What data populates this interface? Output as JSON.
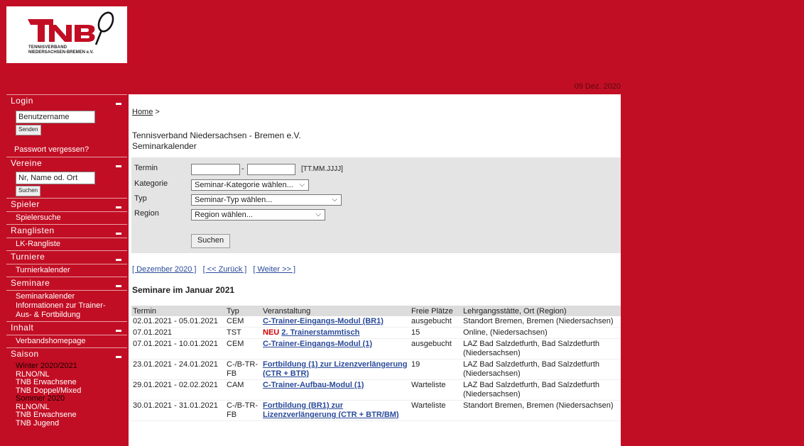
{
  "header": {
    "logo_line1": "TENNISVERBAND",
    "logo_line2": "NIEDERSACHSEN-BREMEN e.V.",
    "date": "09 Dez. 2020"
  },
  "sidebar": {
    "login": {
      "title": "Login",
      "username_value": "Benutzername",
      "send_label": "Senden",
      "forgot": "Passwort vergessen?"
    },
    "vereine": {
      "title": "Vereine",
      "search_placeholder": "Nr, Name od. Ort",
      "search_label": "Suchen"
    },
    "spieler": {
      "title": "Spieler",
      "item": "Spielersuche"
    },
    "ranglisten": {
      "title": "Ranglisten",
      "item": "LK-Rangliste"
    },
    "turniere": {
      "title": "Turniere",
      "item": "Turnierkalender"
    },
    "seminare": {
      "title": "Seminare",
      "item1": "Seminarkalender",
      "item2": "Informationen zur Trainer-Aus- & Fortbildung"
    },
    "inhalt": {
      "title": "Inhalt",
      "item": "Verbandshomepage"
    },
    "saison": {
      "title": "Saison",
      "winter": "Winter 2020/2021",
      "w1": "RLNO/NL",
      "w2": "TNB Erwachsene",
      "w3": "TNB Doppel/Mixed",
      "sommer": "Sommer 2020",
      "s1": "RLNO/NL",
      "s2": "TNB Erwachsene",
      "s3": "TNB Jugend"
    }
  },
  "main": {
    "breadcrumb_home": "Home",
    "breadcrumb_sep": " >",
    "org_name": "Tennisverband Niedersachsen - Bremen e.V.",
    "page_title": "Seminarkalender",
    "filter": {
      "termin_label": "Termin",
      "date_sep": "-",
      "date_format": "[TT.MM.JJJJ]",
      "kategorie_label": "Kategorie",
      "kategorie_value": "Seminar-Kategorie wählen...",
      "typ_label": "Typ",
      "typ_value": "Seminar-Typ wählen...",
      "region_label": "Region",
      "region_value": "Region wählen...",
      "search_label": "Suchen"
    },
    "nav": {
      "month": "[ Dezember 2020 ]",
      "back": "[ << Zurück ]",
      "next": "[ Weiter >> ]"
    },
    "section_title": "Seminare  im Januar 2021",
    "columns": [
      "Termin",
      "Typ",
      "Veranstaltung",
      "Freie Plätze",
      "Lehrgangsstätte, Ort (Region)"
    ],
    "rows": [
      {
        "termin": "02.01.2021 - 05.01.2021",
        "typ": "CEM",
        "neu": "",
        "veranstaltung": "C-Trainer-Eingangs-Modul (BR1)",
        "plaetze": "ausgebucht",
        "ort": "Standort Bremen, Bremen (Niedersachsen)"
      },
      {
        "termin": "07.01.2021",
        "typ": "TST",
        "neu": "NEU",
        "veranstaltung": "2. Trainerstammtisch",
        "plaetze": "15",
        "ort": "Online, (Niedersachsen)"
      },
      {
        "termin": "07.01.2021 - 10.01.2021",
        "typ": "CEM",
        "neu": "",
        "veranstaltung": "C-Trainer-Eingangs-Modul (1)",
        "plaetze": "ausgebucht",
        "ort": "LAZ Bad Salzdetfurth, Bad Salzdetfurth (Niedersachsen)"
      },
      {
        "termin": "23.01.2021 - 24.01.2021",
        "typ": "C-/B-TR-FB",
        "neu": "",
        "veranstaltung": "Fortbildung (1) zur Lizenzverlängerung (CTR + BTR)",
        "plaetze": "19",
        "ort": "LAZ Bad Salzdetfurth, Bad Salzdetfurth (Niedersachsen)"
      },
      {
        "termin": "29.01.2021 - 02.02.2021",
        "typ": "CAM",
        "neu": "",
        "veranstaltung": "C-Trainer-Aufbau-Modul (1)",
        "plaetze": "Warteliste",
        "ort": "LAZ Bad Salzdetfurth, Bad Salzdetfurth (Niedersachsen)"
      },
      {
        "termin": "30.01.2021 - 31.01.2021",
        "typ": "C-/B-TR-FB",
        "neu": "",
        "veranstaltung": "Fortbildung (BR1) zur Lizenzverlängerung (CTR + BTR/BM)",
        "plaetze": "Warteliste",
        "ort": "Standort Bremen, Bremen (Niedersachsen)"
      }
    ]
  },
  "colors": {
    "brand_red": "#c20e24",
    "link_blue": "#2a4a99",
    "neu_red": "#d10000"
  }
}
